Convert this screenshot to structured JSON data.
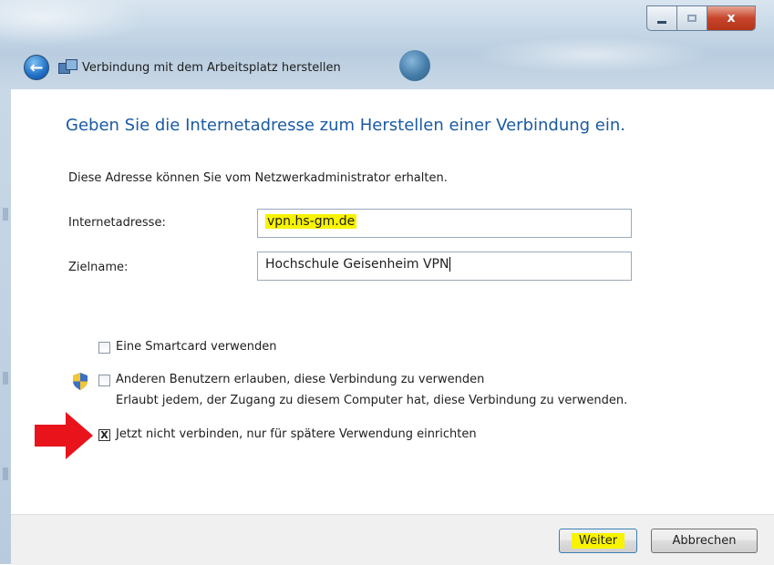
{
  "window": {
    "title": "Verbindung mit dem Arbeitsplatz herstellen",
    "close_glyph": "x"
  },
  "page": {
    "heading": "Geben Sie die Internetadresse zum Herstellen einer Verbindung ein.",
    "description": "Diese Adresse können Sie vom Netzwerkadministrator erhalten."
  },
  "form": {
    "address_label": "Internetadresse:",
    "address_value": "vpn.hs-gm.de",
    "target_label": "Zielname:",
    "target_value": "Hochschule Geisenheim VPN"
  },
  "options": {
    "smartcard_label": "Eine Smartcard verwenden",
    "smartcard_checked": false,
    "allow_others_label": "Anderen Benutzern erlauben, diese Verbindung zu verwenden",
    "allow_others_note": "Erlaubt jedem, der Zugang zu diesem Computer hat, diese Verbindung zu verwenden.",
    "allow_others_checked": false,
    "dont_connect_label": "Jetzt nicht verbinden, nur für spätere Verwendung einrichten",
    "dont_connect_checked": true,
    "check_glyph": "X"
  },
  "footer": {
    "next_label": "Weiter",
    "cancel_label": "Abbrechen"
  },
  "icons": {
    "back": "back-arrow-icon",
    "network": "network-connection-icon",
    "shield": "uac-shield-icon",
    "annotation": "red-arrow-icon"
  },
  "colors": {
    "heading": "#1a5aa3",
    "highlight": "#f8f300",
    "annotation_arrow": "#e8131b"
  }
}
